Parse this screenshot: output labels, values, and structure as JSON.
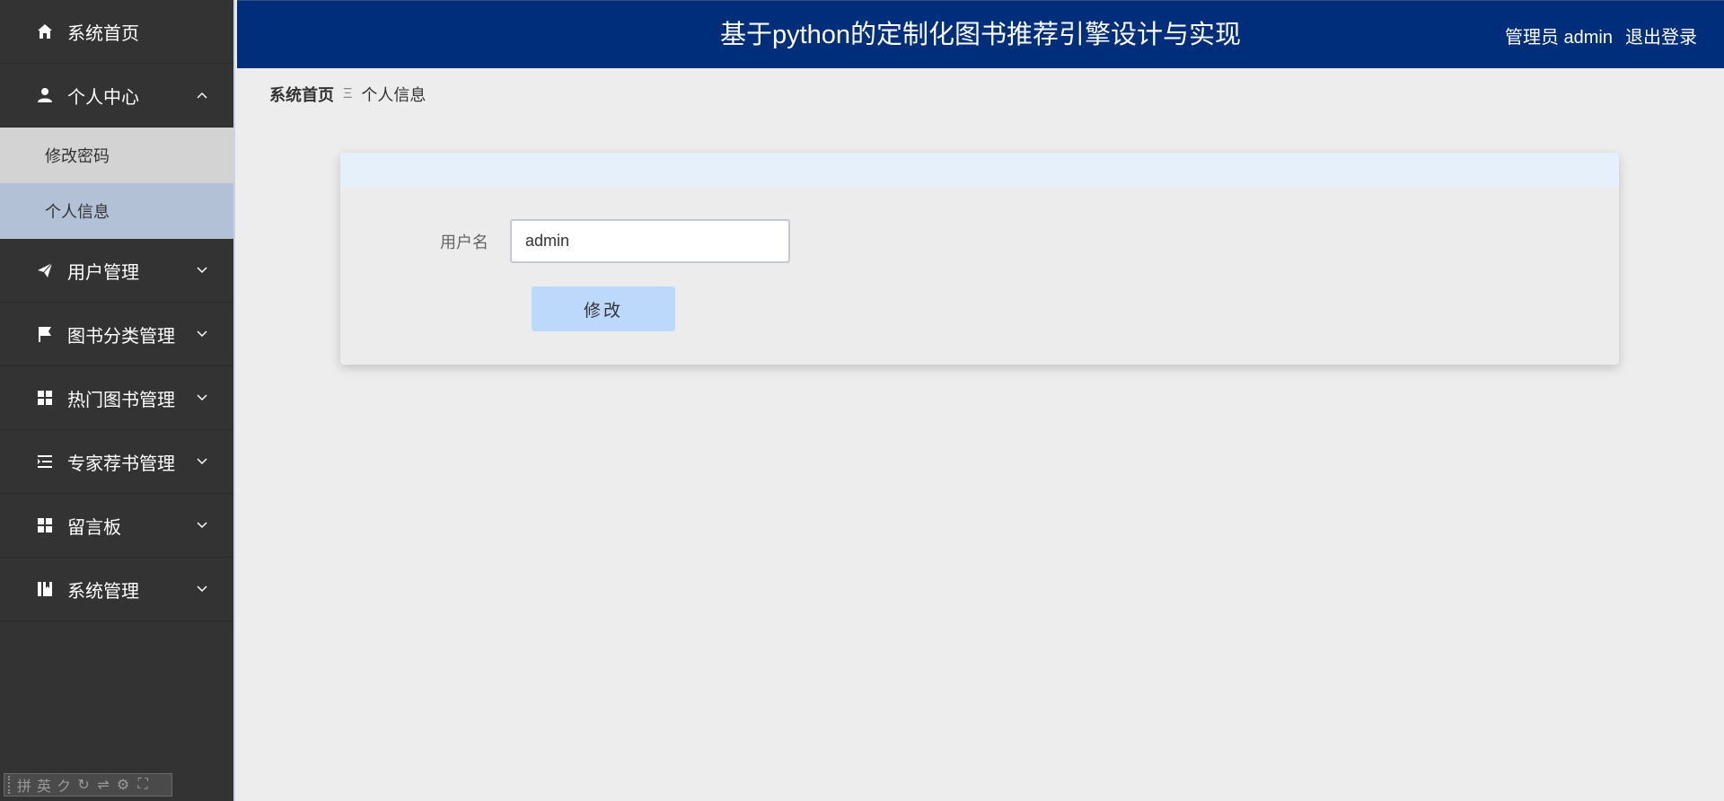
{
  "app": {
    "title": "基于python的定制化图书推荐引擎设计与实现"
  },
  "header": {
    "user_label": "管理员 admin",
    "logout_label": "退出登录"
  },
  "sidebar": {
    "items": [
      {
        "label": "系统首页",
        "icon": "home-icon"
      },
      {
        "label": "个人中心",
        "icon": "user-icon",
        "expanded": true,
        "children": [
          {
            "label": "修改密码"
          },
          {
            "label": "个人信息",
            "active": true
          }
        ]
      },
      {
        "label": "用户管理",
        "icon": "paper-plane-icon"
      },
      {
        "label": "图书分类管理",
        "icon": "flag-icon"
      },
      {
        "label": "热门图书管理",
        "icon": "grid-icon"
      },
      {
        "label": "专家荐书管理",
        "icon": "list-indent-icon"
      },
      {
        "label": "留言板",
        "icon": "grid-icon"
      },
      {
        "label": "系统管理",
        "icon": "book-icon"
      }
    ],
    "ime_toolbar": [
      "拼",
      "英",
      "ク",
      "↻",
      "⇌",
      "⚙",
      "⛶"
    ]
  },
  "breadcrumb": {
    "home": "系统首页",
    "separator": "Ξ",
    "current": "个人信息"
  },
  "form": {
    "username_label": "用户名",
    "username_value": "admin",
    "submit_label": "修改"
  },
  "colors": {
    "header_bg": "#002e7a",
    "sidebar_bg": "#333333",
    "sidebar_active_bg": "#b3c1d6",
    "button_bg": "#bcd9fc",
    "card_head_bg": "#e5f0fb"
  }
}
